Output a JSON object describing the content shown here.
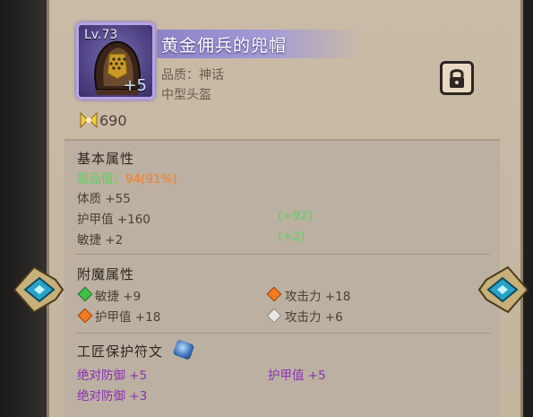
{
  "item": {
    "level_label": "Lv.73",
    "plus_label": "+5",
    "name": "黄金佣兵的兜帽",
    "quality": "品质：神话",
    "type": "中型头盔",
    "power_value": "690"
  },
  "sections": {
    "basic": {
      "title": "基本属性",
      "rows": [
        {
          "label": "极品值：",
          "value": "94(91%)",
          "bonus": ""
        },
        {
          "label": "体质 +55",
          "value": "",
          "bonus": ""
        },
        {
          "label": "护甲值 +160",
          "value": "",
          "bonus": "(+92)"
        },
        {
          "label": "敏捷 +2",
          "value": "",
          "bonus": "(+2)"
        }
      ]
    },
    "enchant": {
      "title": "附魔属性",
      "left": [
        {
          "gem": "green",
          "text": "敏捷 +9"
        },
        {
          "gem": "orange",
          "text": "护甲值 +18"
        }
      ],
      "right": [
        {
          "gem": "orange",
          "text": "攻击力 +18"
        },
        {
          "gem": "white",
          "text": "攻击力 +6"
        }
      ]
    },
    "runes": {
      "title": "工匠保护符文",
      "left": [
        "绝对防御 +5",
        "绝对防御 +3"
      ],
      "right": [
        "护甲值 +5"
      ]
    }
  },
  "icons": {
    "lock": "lock-icon",
    "power": "power-icon",
    "rune": "rune-icon"
  },
  "colors": {
    "accent_purple": "#8d2fb7",
    "green": "#5fd25f",
    "orange": "#ff7a20",
    "panel": "#c9bba6"
  }
}
